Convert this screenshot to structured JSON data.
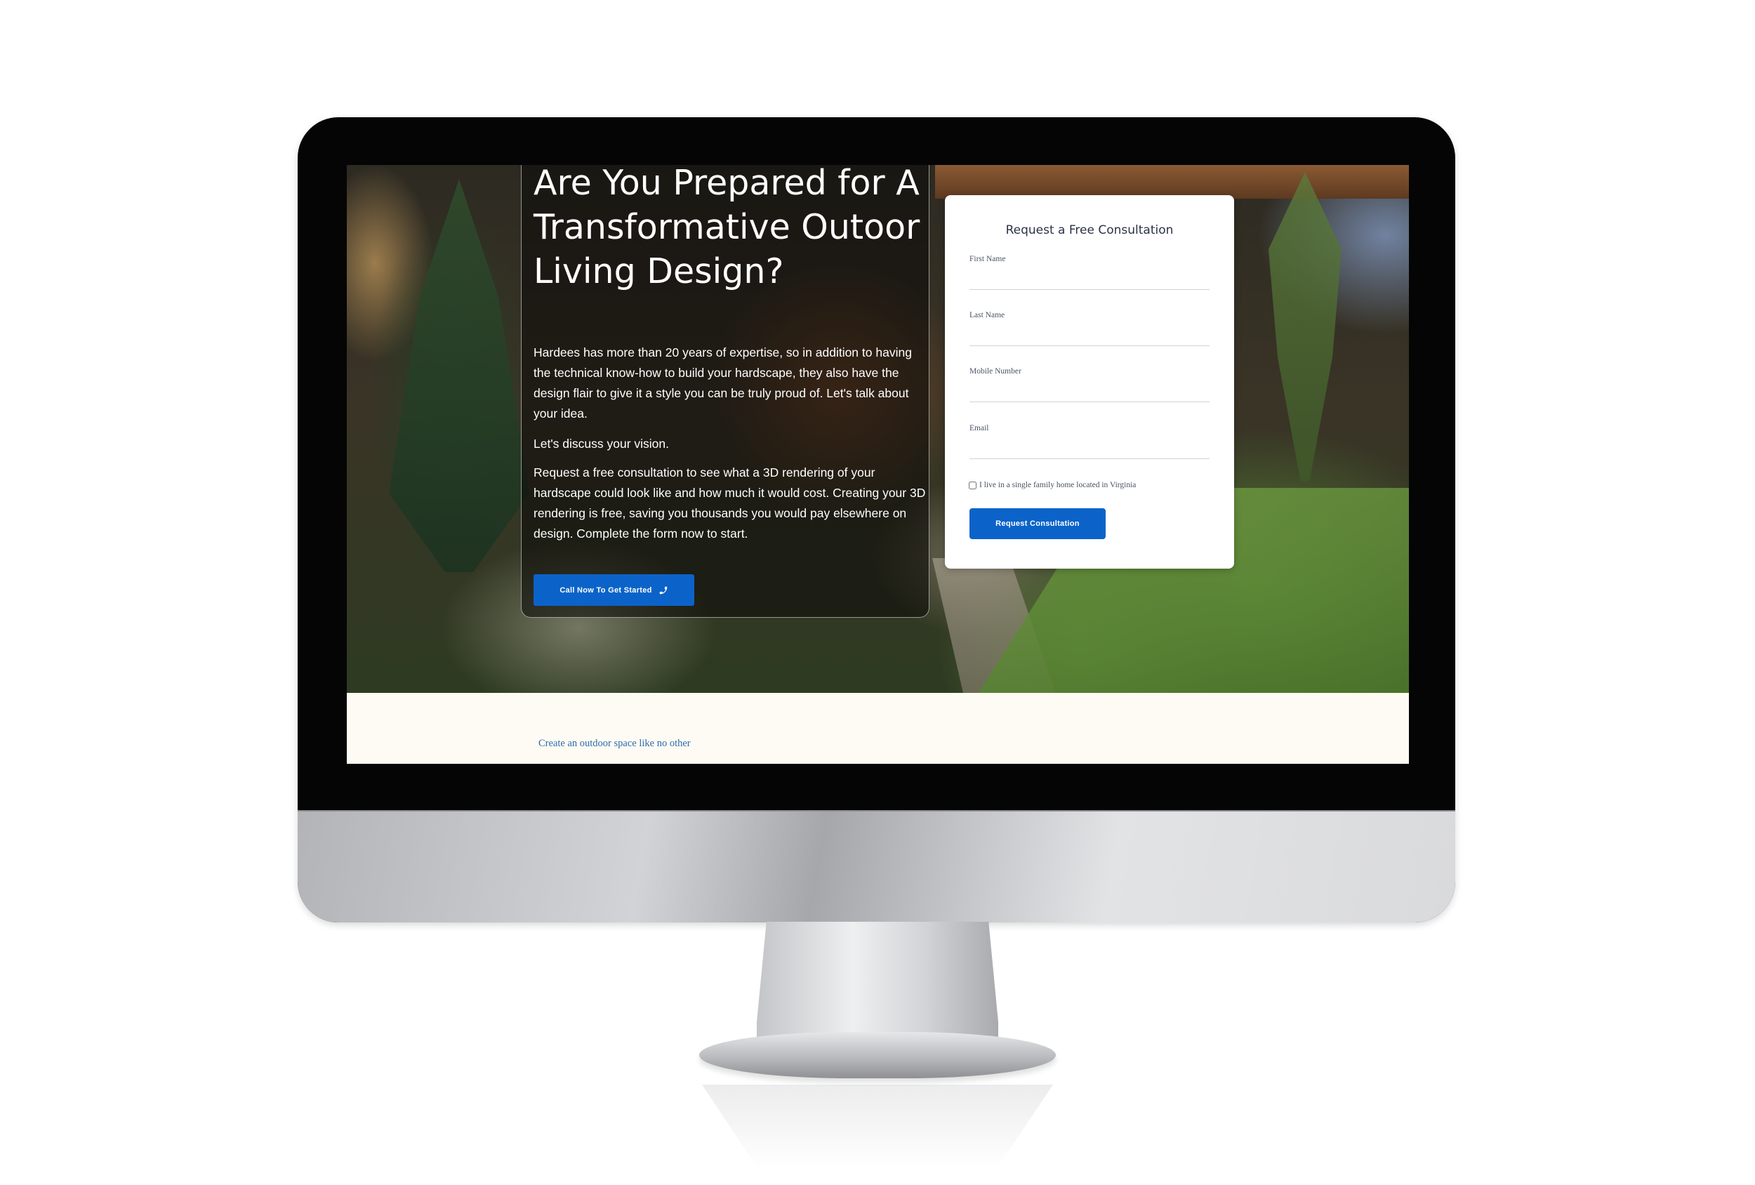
{
  "hero": {
    "title": "Are You Prepared for A Transformative Outoor Living Design?",
    "paragraph_1": "Hardees has more than 20 years of expertise, so in addition to having the technical know-how to build your hardscape, they also have the design flair to give it a style you can be truly proud of. Let's talk about your idea.",
    "paragraph_2": "Let's discuss your vision.",
    "paragraph_3": "Request a free consultation to see what a 3D rendering of your hardscape could look like and how much it would cost. Creating your 3D rendering is free, saving you thousands you would pay elsewhere on design. Complete the form now to start.",
    "call_button_label": "Call Now To Get Started",
    "call_button_icon": "phone-icon"
  },
  "form": {
    "title": "Request a Free Consultation",
    "fields": [
      {
        "label": "First Name",
        "value": ""
      },
      {
        "label": "Last Name",
        "value": ""
      },
      {
        "label": "Mobile Number",
        "value": ""
      },
      {
        "label": "Email",
        "value": ""
      }
    ],
    "checkbox_label": "I live in a single family home located in Virginia",
    "checkbox_checked": false,
    "submit_label": "Request Consultation"
  },
  "below": {
    "tagline": "Create an outdoor space like no other"
  },
  "colors": {
    "accent": "#0b63c9",
    "tagline": "#2f6bb0",
    "form_title": "#2a3246",
    "strip_background": "#fdfbf3"
  }
}
